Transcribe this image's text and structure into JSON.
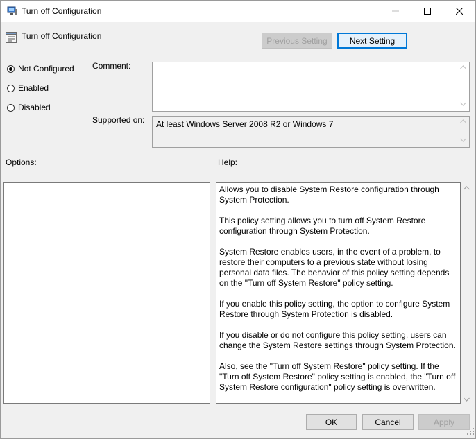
{
  "window": {
    "title": "Turn off Configuration",
    "icons": {
      "app": "policy-editor-icon",
      "minimize": "minimize-icon",
      "maximize": "maximize-icon",
      "close": "close-icon"
    }
  },
  "header": {
    "title": "Turn off Configuration",
    "icon": "setting-icon",
    "previous_label": "Previous Setting",
    "next_label": "Next Setting"
  },
  "state": {
    "options": [
      {
        "label": "Not Configured",
        "checked": true
      },
      {
        "label": "Enabled",
        "checked": false
      },
      {
        "label": "Disabled",
        "checked": false
      }
    ]
  },
  "comment": {
    "label": "Comment:",
    "value": ""
  },
  "supported": {
    "label": "Supported on:",
    "value": "At least Windows Server 2008 R2 or Windows 7"
  },
  "options_panel": {
    "label": "Options:"
  },
  "help": {
    "label": "Help:",
    "paragraphs": [
      "Allows you to disable System Restore configuration through System Protection.",
      "This policy setting allows you to turn off System Restore configuration through System Protection.",
      "System Restore enables users, in the event of a problem, to restore their computers to a previous state without losing personal data files. The behavior of this policy setting depends on the \"Turn off System Restore\" policy setting.",
      "If you enable this policy setting, the option to configure System Restore through System Protection is disabled.",
      "If you disable or do not configure this policy setting, users can change the System Restore settings through System Protection.",
      "Also, see the \"Turn off System Restore\" policy setting. If the \"Turn off System Restore\" policy setting is enabled, the \"Turn off System Restore configuration\" policy setting is overwritten."
    ]
  },
  "footer": {
    "ok_label": "OK",
    "cancel_label": "Cancel",
    "apply_label": "Apply"
  },
  "colors": {
    "accent": "#0078d7",
    "window_bg": "#f0f0f0",
    "disabled_text": "#a0a0a0"
  }
}
